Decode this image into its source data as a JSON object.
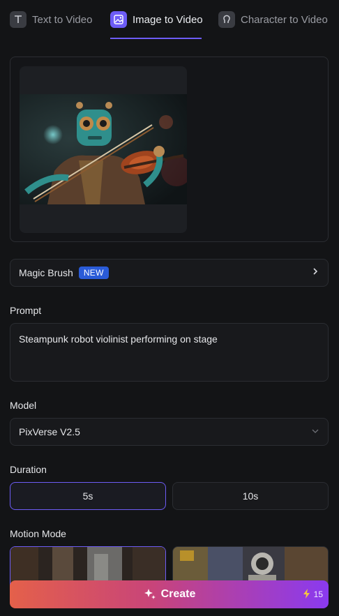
{
  "tabs": [
    {
      "label": "Text to Video",
      "icon": "text-icon",
      "active": false
    },
    {
      "label": "Image to Video",
      "icon": "image-icon",
      "active": true
    },
    {
      "label": "Character to Video",
      "icon": "character-icon",
      "active": false
    }
  ],
  "magic_brush": {
    "label": "Magic Brush",
    "badge": "NEW"
  },
  "prompt": {
    "label": "Prompt",
    "value": "Steampunk robot violinist performing on stage"
  },
  "model": {
    "label": "Model",
    "selected": "PixVerse V2.5"
  },
  "duration": {
    "label": "Duration",
    "options": [
      "5s",
      "10s"
    ],
    "selected": "5s"
  },
  "motion_mode": {
    "label": "Motion Mode"
  },
  "create": {
    "label": "Create",
    "credits": "15"
  },
  "colors": {
    "accent": "#6d5cf6",
    "badge": "#2a5bd7",
    "background": "#131416"
  }
}
